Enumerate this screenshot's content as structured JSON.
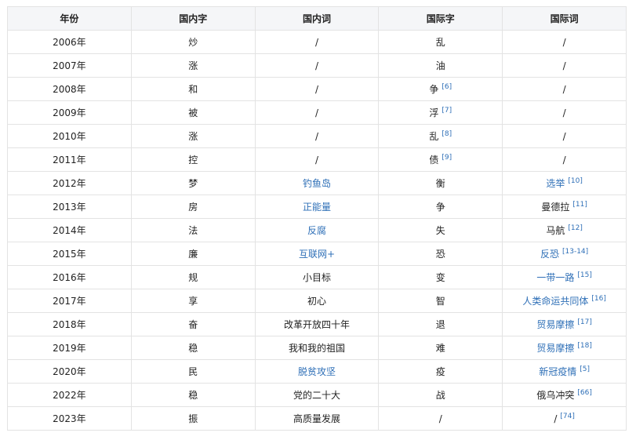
{
  "table": {
    "headers": [
      "年份",
      "国内字",
      "国内词",
      "国际字",
      "国际词"
    ],
    "rows": [
      {
        "year": "2006年",
        "dchar": "炒",
        "dword": "/",
        "dword_link": false,
        "ichar": "乱",
        "ichar_ref": "",
        "iword": "/",
        "iword_link": false,
        "iword_ref": ""
      },
      {
        "year": "2007年",
        "dchar": "涨",
        "dword": "/",
        "dword_link": false,
        "ichar": "油",
        "ichar_ref": "",
        "iword": "/",
        "iword_link": false,
        "iword_ref": ""
      },
      {
        "year": "2008年",
        "dchar": "和",
        "dword": "/",
        "dword_link": false,
        "ichar": "争",
        "ichar_ref": "[6]",
        "iword": "/",
        "iword_link": false,
        "iword_ref": ""
      },
      {
        "year": "2009年",
        "dchar": "被",
        "dword": "/",
        "dword_link": false,
        "ichar": "浮",
        "ichar_ref": "[7]",
        "iword": "/",
        "iword_link": false,
        "iword_ref": ""
      },
      {
        "year": "2010年",
        "dchar": "涨",
        "dword": "/",
        "dword_link": false,
        "ichar": "乱",
        "ichar_ref": "[8]",
        "iword": "/",
        "iword_link": false,
        "iword_ref": ""
      },
      {
        "year": "2011年",
        "dchar": "控",
        "dword": "/",
        "dword_link": false,
        "ichar": "债",
        "ichar_ref": "[9]",
        "iword": "/",
        "iword_link": false,
        "iword_ref": ""
      },
      {
        "year": "2012年",
        "dchar": "梦",
        "dword": "钓鱼岛",
        "dword_link": true,
        "ichar": "衡",
        "ichar_ref": "",
        "iword": "选举",
        "iword_link": true,
        "iword_ref": "[10]"
      },
      {
        "year": "2013年",
        "dchar": "房",
        "dword": "正能量",
        "dword_link": true,
        "ichar": "争",
        "ichar_ref": "",
        "iword": "曼德拉",
        "iword_link": false,
        "iword_ref": "[11]"
      },
      {
        "year": "2014年",
        "dchar": "法",
        "dword": "反腐",
        "dword_link": true,
        "ichar": "失",
        "ichar_ref": "",
        "iword": "马航",
        "iword_link": false,
        "iword_ref": "[12]"
      },
      {
        "year": "2015年",
        "dchar": "廉",
        "dword": "互联网+",
        "dword_link": true,
        "ichar": "恐",
        "ichar_ref": "",
        "iword": "反恐",
        "iword_link": true,
        "iword_ref": "[13-14]"
      },
      {
        "year": "2016年",
        "dchar": "规",
        "dword": "小目标",
        "dword_link": false,
        "ichar": "变",
        "ichar_ref": "",
        "iword": "一带一路",
        "iword_link": true,
        "iword_ref": "[15]"
      },
      {
        "year": "2017年",
        "dchar": "享",
        "dword": "初心",
        "dword_link": false,
        "ichar": "智",
        "ichar_ref": "",
        "iword": "人类命运共同体",
        "iword_link": true,
        "iword_ref": "[16]"
      },
      {
        "year": "2018年",
        "dchar": "奋",
        "dword": "改革开放四十年",
        "dword_link": false,
        "ichar": "退",
        "ichar_ref": "",
        "iword": "贸易摩擦",
        "iword_link": true,
        "iword_ref": "[17]"
      },
      {
        "year": "2019年",
        "dchar": "稳",
        "dword": "我和我的祖国",
        "dword_link": false,
        "ichar": "难",
        "ichar_ref": "",
        "iword": "贸易摩擦",
        "iword_link": true,
        "iword_ref": "[18]"
      },
      {
        "year": "2020年",
        "dchar": "民",
        "dword": "脱贫攻坚",
        "dword_link": true,
        "ichar": "疫",
        "ichar_ref": "",
        "iword": "新冠疫情",
        "iword_link": true,
        "iword_ref": "[5]"
      },
      {
        "year": "2022年",
        "dchar": "稳",
        "dword": "党的二十大",
        "dword_link": false,
        "ichar": "战",
        "ichar_ref": "",
        "iword": "俄乌冲突",
        "iword_link": false,
        "iword_ref": "[66]"
      },
      {
        "year": "2023年",
        "dchar": "振",
        "dword": "高质量发展",
        "dword_link": false,
        "ichar": "/",
        "ichar_ref": "",
        "iword": "/",
        "iword_link": false,
        "iword_ref": "[74]"
      }
    ]
  },
  "colors": {
    "link": "#2e6fb7",
    "header_bg": "#f5f6f8",
    "border": "#e3e3e3"
  }
}
